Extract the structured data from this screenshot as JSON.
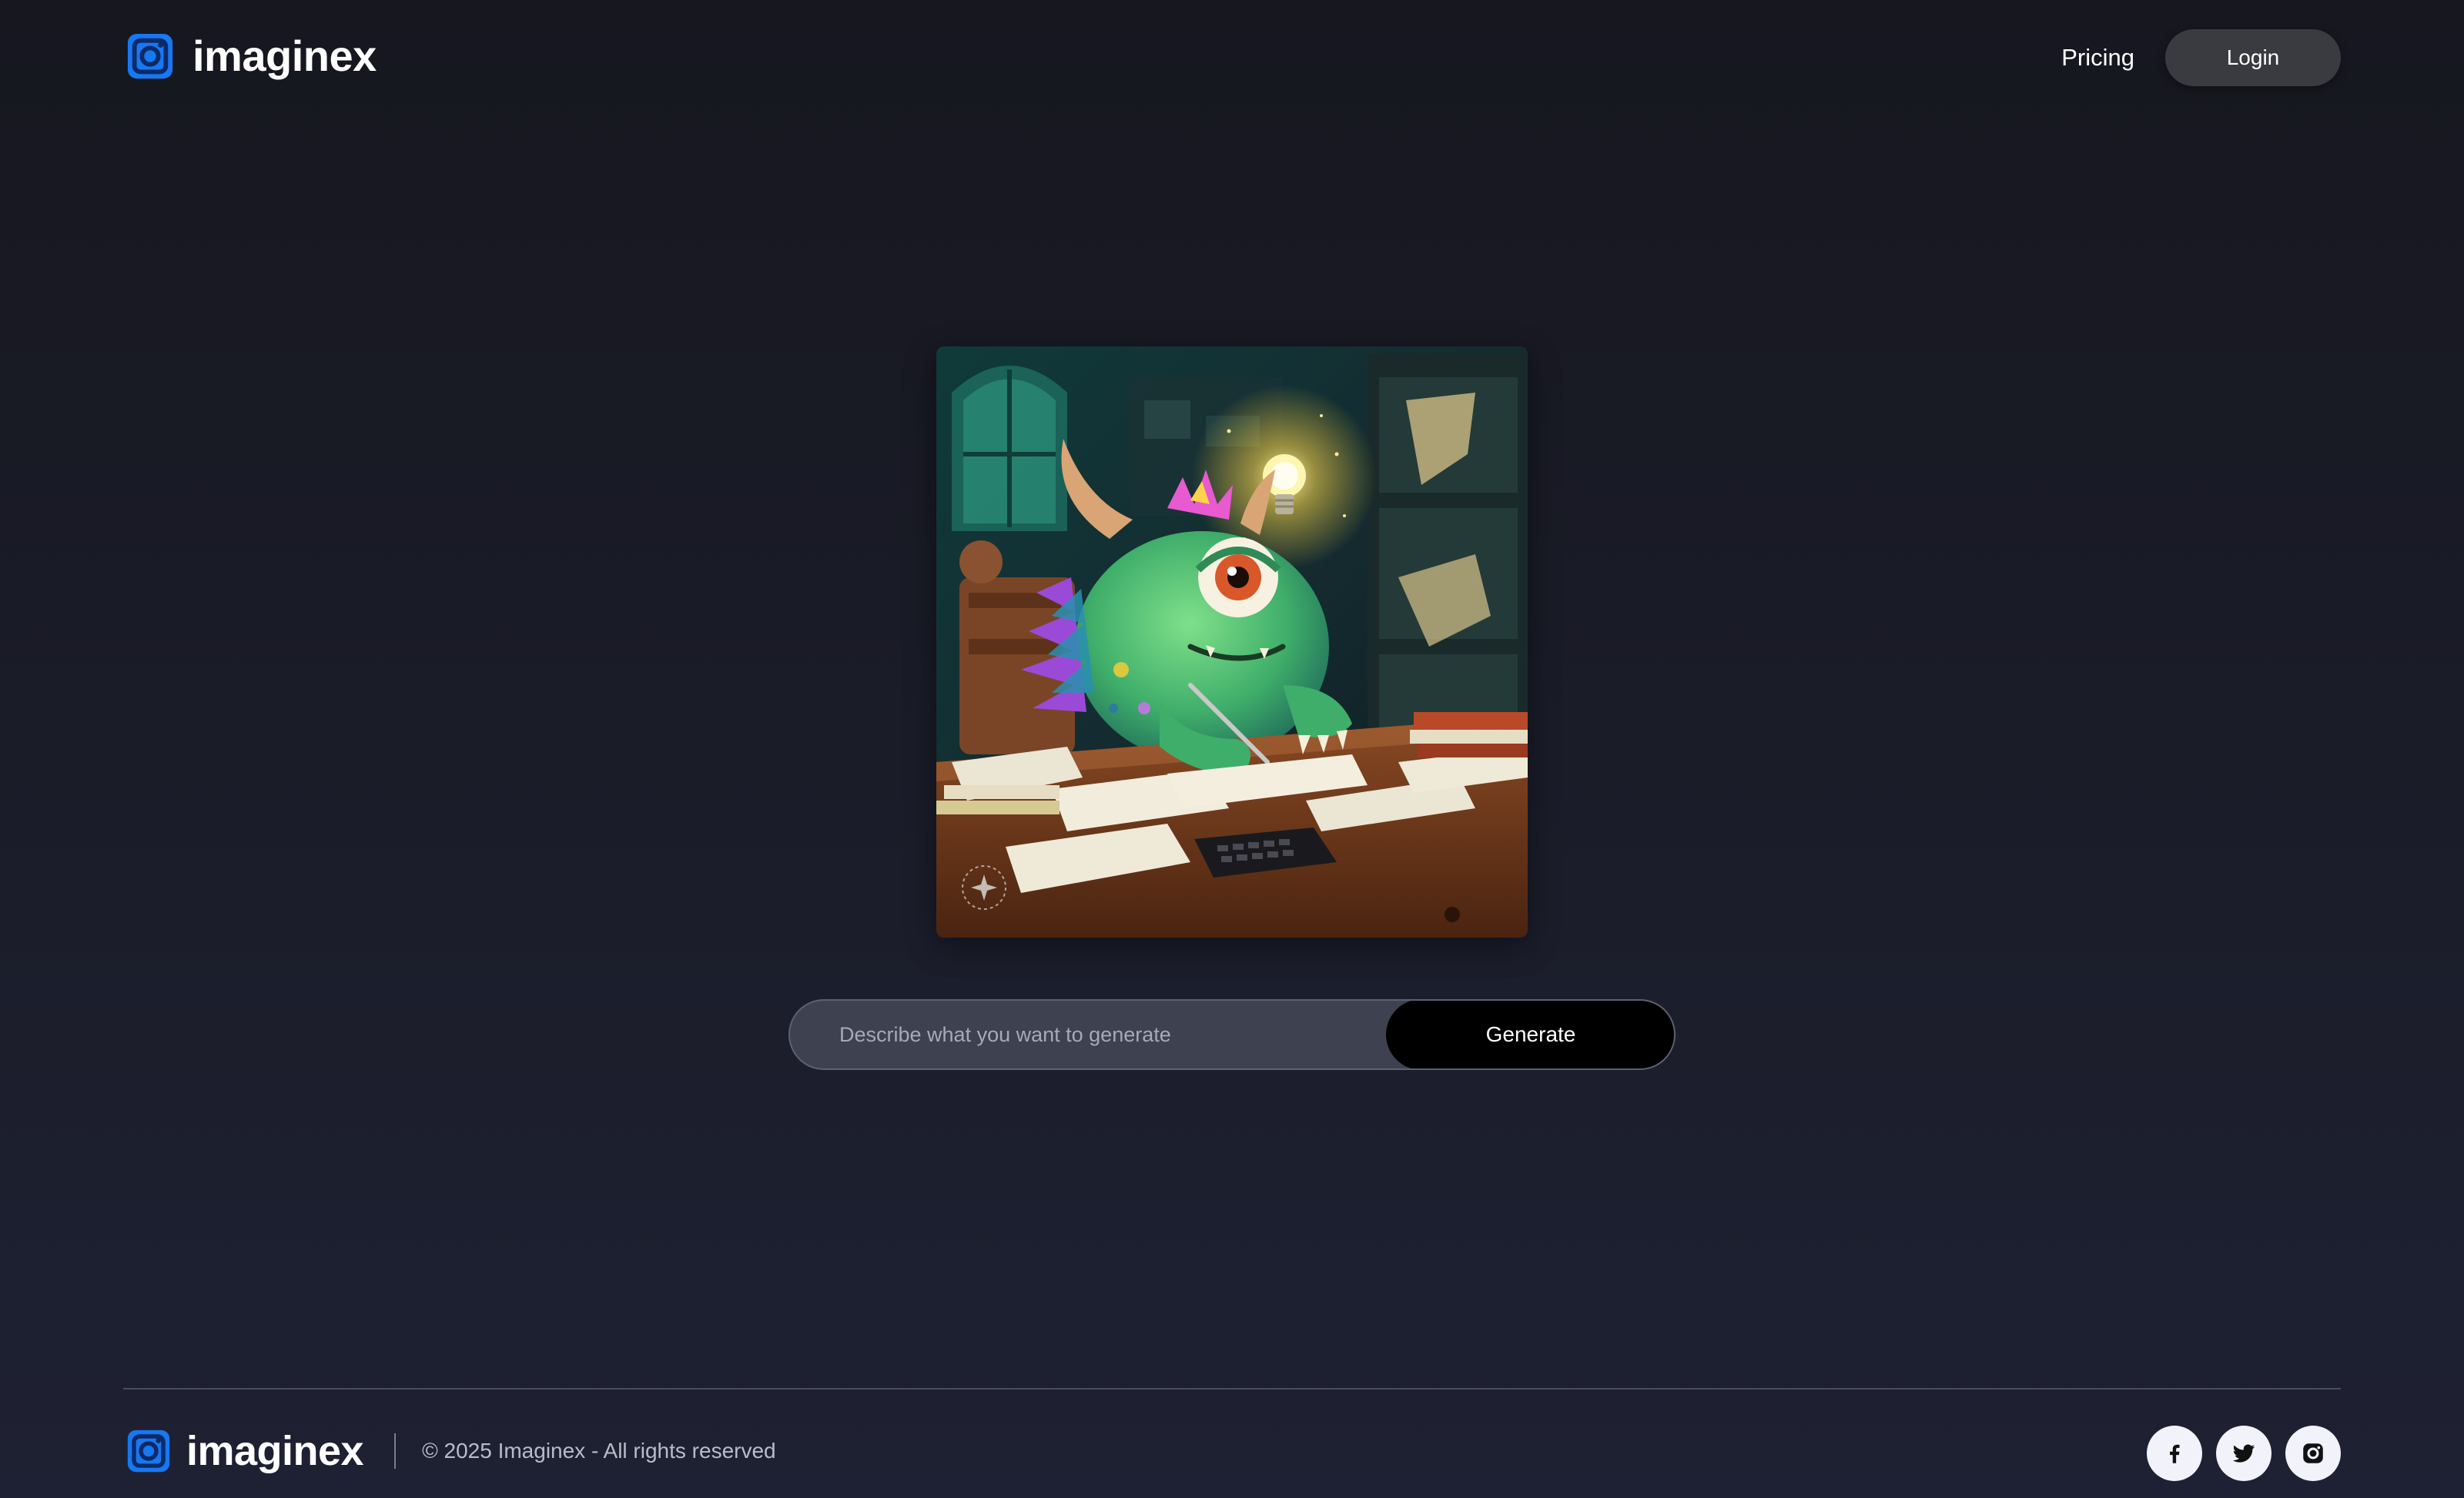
{
  "header": {
    "brand_name": "imaginex",
    "nav": {
      "pricing_label": "Pricing",
      "login_label": "Login"
    }
  },
  "hero": {
    "image_subject": "one-eyed green monster at desk with glowing lightbulb"
  },
  "prompt": {
    "placeholder": "Describe what you want to generate",
    "value": "",
    "generate_label": "Generate"
  },
  "footer": {
    "brand_name": "imaginex",
    "copyright": "© 2025 Imaginex - All rights reserved",
    "socials": [
      {
        "icon": "facebook-icon"
      },
      {
        "icon": "twitter-icon"
      },
      {
        "icon": "instagram-icon"
      }
    ]
  },
  "colors": {
    "brand_blue": "#1877f2",
    "background_top": "#16171f",
    "background_bottom": "#1e2133",
    "login_button_bg": "#3a3b40",
    "generate_button_bg": "#000000",
    "prompt_bar_bg": "#3e4150",
    "social_button_bg": "#f1f2fa"
  }
}
